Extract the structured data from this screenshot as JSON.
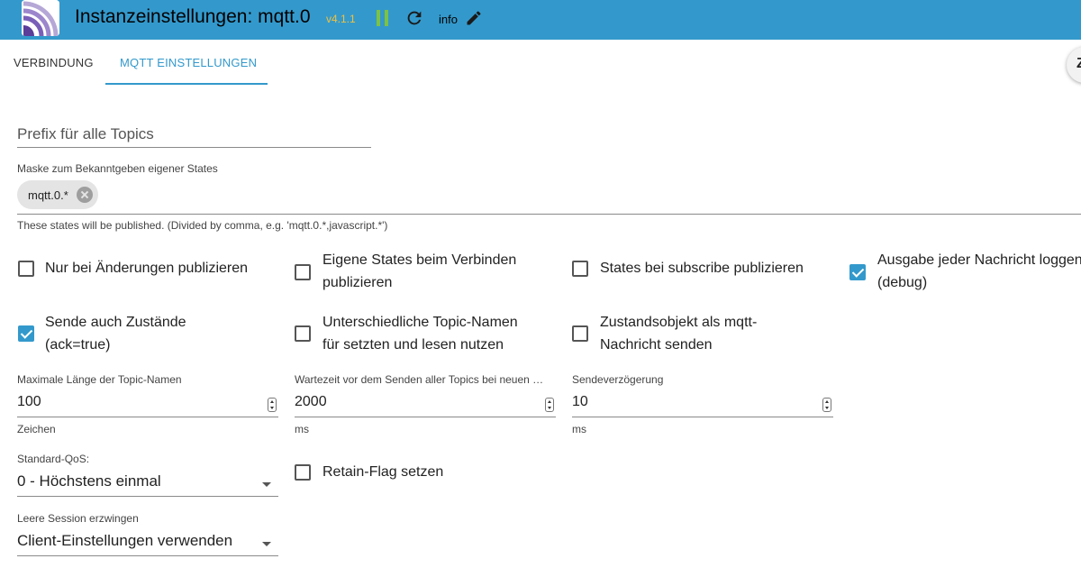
{
  "header": {
    "title": "Instanzeinstellungen: mqtt.0",
    "version": "v4.1.1",
    "info_label": "info",
    "color": "#3399cc"
  },
  "tabs": [
    {
      "label": "VERBINDUNG",
      "active": false
    },
    {
      "label": "MQTT EINSTELLUNGEN",
      "active": true
    }
  ],
  "corner_button": {
    "icon": "Z"
  },
  "prefix": {
    "placeholder": "Prefix für alle Topics",
    "value": ""
  },
  "mask": {
    "label": "Maske zum Bekanntgeben eigener States",
    "chips": [
      "mqtt.0.*"
    ],
    "helper": "These states will be published. (Divided by comma, e.g. 'mqtt.0.*,javascript.*')"
  },
  "checkboxes": {
    "only_changes": {
      "label": "Nur bei Änderungen publizieren",
      "checked": false
    },
    "own_states_line1": "Eigene States beim Verbinden",
    "own_states_line2": "publizieren",
    "own_states_checked": false,
    "subscribe_states": {
      "label": "States bei subscribe publizieren",
      "checked": false
    },
    "log_line1": "Ausgabe jeder Nachricht loggen",
    "log_line2": "(debug)",
    "log_checked": true,
    "ack_line1": "Sende auch Zustände",
    "ack_line2": "(ack=true)",
    "ack_checked": true,
    "topics_line1": "Unterschiedliche Topic-Namen",
    "topics_line2": "für setzten und lesen nutzen",
    "topics_checked": false,
    "object_line1": "Zustandsobjekt als mqtt-",
    "object_line2": "Nachricht senden",
    "object_checked": false,
    "retain": {
      "label": "Retain-Flag setzen",
      "checked": false
    }
  },
  "numbers": {
    "max_length": {
      "label": "Maximale Länge der Topic-Namen",
      "value": "100",
      "unit": "Zeichen"
    },
    "wait_time": {
      "label": "Wartezeit vor dem Senden aller Topics bei neuen …",
      "value": "2000",
      "unit": "ms"
    },
    "send_delay": {
      "label": "Sendeverzögerung",
      "value": "10",
      "unit": "ms"
    }
  },
  "selects": {
    "qos": {
      "label": "Standard-QoS:",
      "value": "0 - Höchstens einmal"
    },
    "session": {
      "label": "Leere Session erzwingen",
      "value": "Client-Einstellungen verwenden"
    }
  }
}
